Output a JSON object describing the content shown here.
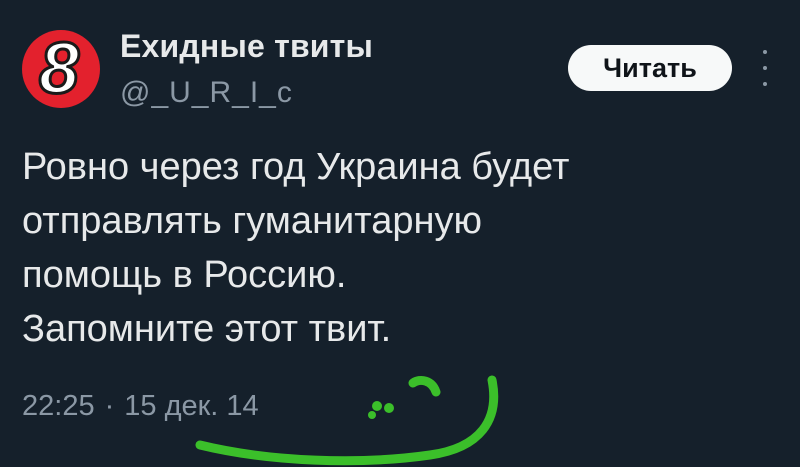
{
  "author": {
    "name": "Ехидные твиты",
    "handle": "@_U_R_I_c",
    "avatar_text": "8",
    "avatar_color": "#e3212d"
  },
  "actions": {
    "read_label": "Читать"
  },
  "tweet": {
    "lines": [
      "Ровно через год Украина будет",
      "отправлять гуманитарную",
      "помощь в Россию.",
      "Запомните этот твит."
    ]
  },
  "meta": {
    "time": "22:25",
    "separator": "·",
    "date": "15 дек. 14"
  },
  "colors": {
    "background": "#15202b",
    "scribble": "#3bbf2a"
  }
}
